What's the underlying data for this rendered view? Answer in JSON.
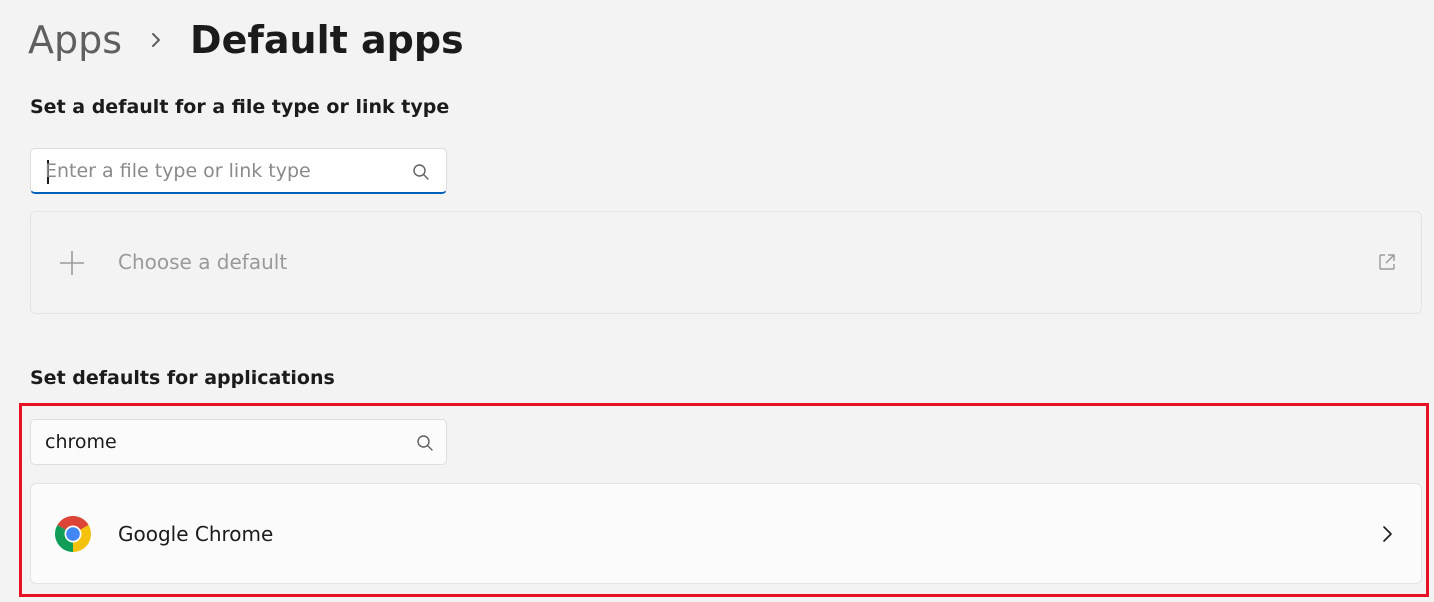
{
  "breadcrumb": {
    "parent": "Apps",
    "current": "Default apps"
  },
  "file_type_section": {
    "title": "Set a default for a file type or link type",
    "search_placeholder": "Enter a file type or link type",
    "search_value": "",
    "choose_default_label": "Choose a default"
  },
  "apps_section": {
    "title": "Set defaults for applications",
    "search_value": "chrome",
    "results": [
      {
        "name": "Google Chrome",
        "icon": "chrome-icon"
      }
    ]
  },
  "colors": {
    "accent": "#005fb8",
    "highlight": "#e81123",
    "background": "#f3f3f3"
  }
}
